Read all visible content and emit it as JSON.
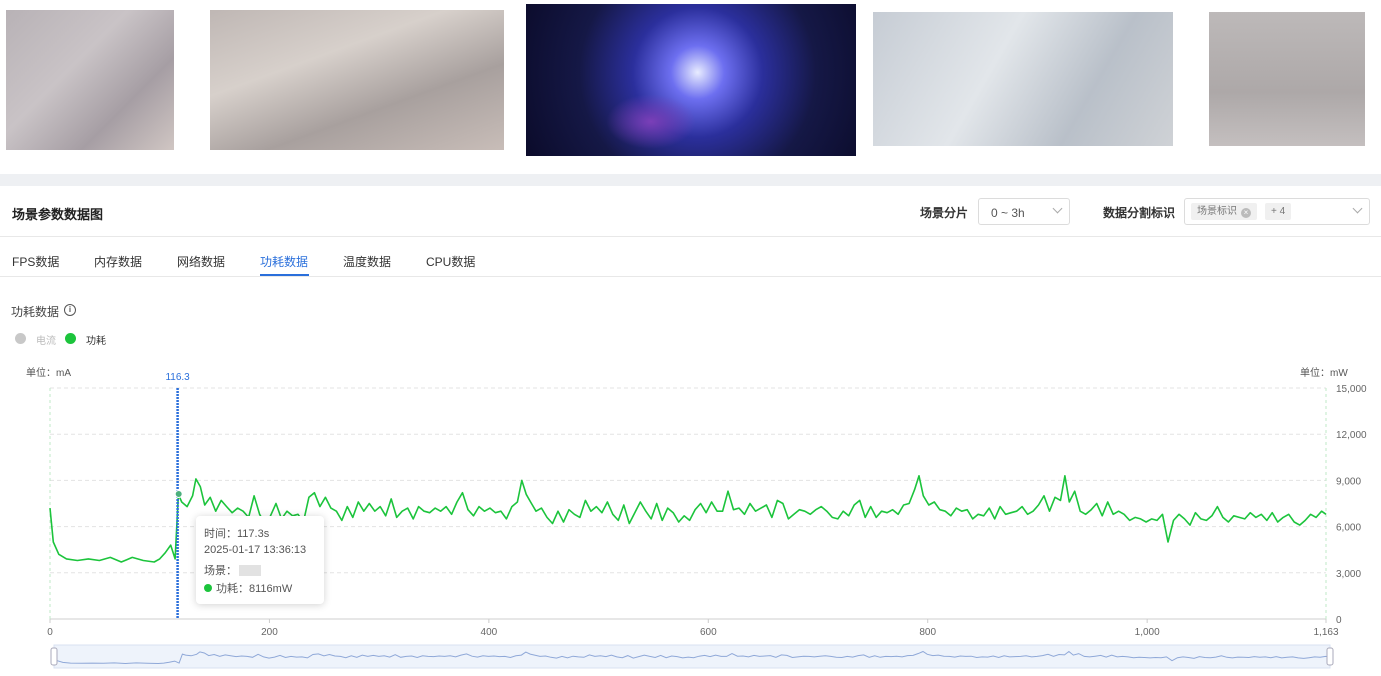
{
  "thumbnails": [
    "thumb-1",
    "thumb-2",
    "thumb-3",
    "thumb-4",
    "thumb-5"
  ],
  "header": {
    "title": "场景参数数据图",
    "slice_label": "场景分片",
    "slice_value": "0 ~ 3h",
    "split_label": "数据分割标识",
    "split_tag": "场景标识",
    "split_more": "+ 4"
  },
  "tabs": [
    {
      "label": "FPS数据",
      "active": false
    },
    {
      "label": "内存数据",
      "active": false
    },
    {
      "label": "网络数据",
      "active": false
    },
    {
      "label": "功耗数据",
      "active": true
    },
    {
      "label": "温度数据",
      "active": false
    },
    {
      "label": "CPU数据",
      "active": false
    }
  ],
  "section": {
    "title": "功耗数据",
    "info_icon": "i"
  },
  "legend": {
    "current": {
      "label": "电流",
      "color": "#c8c8c8"
    },
    "power": {
      "label": "功耗",
      "color": "#1cc43c"
    }
  },
  "units": {
    "left": "单位：mA",
    "right": "单位：mW"
  },
  "tooltip": {
    "time": "时间：117.3s",
    "datetime": "2025-01-17 13:36:13",
    "scene": "场景：",
    "power": "功耗：8116mW"
  },
  "cursor_label": "116.3",
  "colors": {
    "accent": "#2a6fdb",
    "series": "#1cc43c",
    "grid": "#e3e3e3"
  },
  "chart_data": {
    "type": "line",
    "title": "",
    "xlabel": "",
    "ylabel_right": "单位：mW",
    "ylabel_left": "单位：mA",
    "xlim": [
      0,
      1163
    ],
    "ylim": [
      0,
      15000
    ],
    "x_ticks": [
      0,
      200,
      400,
      600,
      800,
      1000,
      1163
    ],
    "x_tick_labels": [
      "0",
      "200",
      "400",
      "600",
      "800",
      "1,000",
      "1,163"
    ],
    "y_ticks": [
      0,
      3000,
      6000,
      9000,
      12000,
      15000
    ],
    "y_tick_labels": [
      "0",
      "3,000",
      "6,000",
      "9,000",
      "12,000",
      "15,000"
    ],
    "grid": true,
    "cursor_x": 116.3,
    "series": [
      {
        "name": "功耗",
        "points": [
          [
            0,
            7200
          ],
          [
            3,
            5000
          ],
          [
            8,
            4200
          ],
          [
            15,
            3900
          ],
          [
            25,
            3800
          ],
          [
            35,
            3900
          ],
          [
            45,
            3800
          ],
          [
            55,
            4000
          ],
          [
            65,
            3700
          ],
          [
            75,
            4000
          ],
          [
            85,
            3800
          ],
          [
            95,
            3700
          ],
          [
            100,
            3900
          ],
          [
            105,
            4300
          ],
          [
            110,
            4800
          ],
          [
            114,
            3900
          ],
          [
            117,
            8100
          ],
          [
            120,
            7600
          ],
          [
            125,
            7300
          ],
          [
            130,
            8000
          ],
          [
            133,
            9100
          ],
          [
            137,
            8600
          ],
          [
            141,
            7400
          ],
          [
            146,
            7900
          ],
          [
            151,
            7000
          ],
          [
            156,
            7700
          ],
          [
            161,
            7300
          ],
          [
            166,
            6900
          ],
          [
            171,
            7200
          ],
          [
            176,
            7000
          ],
          [
            181,
            6600
          ],
          [
            186,
            8000
          ],
          [
            191,
            6800
          ],
          [
            196,
            6200
          ],
          [
            201,
            6700
          ],
          [
            206,
            7500
          ],
          [
            211,
            6500
          ],
          [
            216,
            7000
          ],
          [
            221,
            6700
          ],
          [
            226,
            6800
          ],
          [
            231,
            6300
          ],
          [
            236,
            7900
          ],
          [
            241,
            8200
          ],
          [
            246,
            7300
          ],
          [
            251,
            7900
          ],
          [
            256,
            7200
          ],
          [
            261,
            7000
          ],
          [
            266,
            6400
          ],
          [
            271,
            7300
          ],
          [
            276,
            6600
          ],
          [
            281,
            7600
          ],
          [
            286,
            7000
          ],
          [
            291,
            7500
          ],
          [
            296,
            7000
          ],
          [
            301,
            7300
          ],
          [
            306,
            6700
          ],
          [
            311,
            7800
          ],
          [
            316,
            6600
          ],
          [
            321,
            7000
          ],
          [
            326,
            7200
          ],
          [
            331,
            6500
          ],
          [
            336,
            7300
          ],
          [
            341,
            7000
          ],
          [
            346,
            6900
          ],
          [
            351,
            7200
          ],
          [
            356,
            7000
          ],
          [
            361,
            7300
          ],
          [
            366,
            6800
          ],
          [
            371,
            7600
          ],
          [
            376,
            8200
          ],
          [
            381,
            7100
          ],
          [
            386,
            6700
          ],
          [
            391,
            7300
          ],
          [
            396,
            7000
          ],
          [
            401,
            7200
          ],
          [
            406,
            6900
          ],
          [
            411,
            7000
          ],
          [
            416,
            6500
          ],
          [
            421,
            7300
          ],
          [
            426,
            7600
          ],
          [
            430,
            9000
          ],
          [
            434,
            8100
          ],
          [
            438,
            7600
          ],
          [
            443,
            7000
          ],
          [
            448,
            7200
          ],
          [
            453,
            6600
          ],
          [
            458,
            6200
          ],
          [
            463,
            7000
          ],
          [
            468,
            6300
          ],
          [
            473,
            7100
          ],
          [
            478,
            6800
          ],
          [
            483,
            6600
          ],
          [
            488,
            7700
          ],
          [
            493,
            7000
          ],
          [
            498,
            7300
          ],
          [
            503,
            6900
          ],
          [
            508,
            7600
          ],
          [
            513,
            6800
          ],
          [
            518,
            6400
          ],
          [
            523,
            7400
          ],
          [
            528,
            6200
          ],
          [
            533,
            6900
          ],
          [
            538,
            7600
          ],
          [
            543,
            7000
          ],
          [
            548,
            6500
          ],
          [
            553,
            7500
          ],
          [
            558,
            6400
          ],
          [
            563,
            7200
          ],
          [
            568,
            6900
          ],
          [
            573,
            6300
          ],
          [
            578,
            6700
          ],
          [
            583,
            6400
          ],
          [
            588,
            7100
          ],
          [
            593,
            7500
          ],
          [
            598,
            6900
          ],
          [
            603,
            7600
          ],
          [
            608,
            7000
          ],
          [
            613,
            7000
          ],
          [
            618,
            8300
          ],
          [
            623,
            7100
          ],
          [
            628,
            7200
          ],
          [
            633,
            6800
          ],
          [
            638,
            7500
          ],
          [
            643,
            7000
          ],
          [
            648,
            7200
          ],
          [
            653,
            7400
          ],
          [
            658,
            6600
          ],
          [
            663,
            7700
          ],
          [
            668,
            7500
          ],
          [
            673,
            6500
          ],
          [
            678,
            6800
          ],
          [
            683,
            7100
          ],
          [
            688,
            7000
          ],
          [
            693,
            6800
          ],
          [
            698,
            7100
          ],
          [
            703,
            7300
          ],
          [
            708,
            7000
          ],
          [
            713,
            6600
          ],
          [
            718,
            6500
          ],
          [
            723,
            7000
          ],
          [
            728,
            6700
          ],
          [
            733,
            7400
          ],
          [
            738,
            7700
          ],
          [
            743,
            6600
          ],
          [
            748,
            7300
          ],
          [
            753,
            6600
          ],
          [
            758,
            7000
          ],
          [
            763,
            6900
          ],
          [
            768,
            7100
          ],
          [
            773,
            6800
          ],
          [
            778,
            7400
          ],
          [
            783,
            7500
          ],
          [
            788,
            8400
          ],
          [
            792,
            9300
          ],
          [
            796,
            8000
          ],
          [
            801,
            7400
          ],
          [
            806,
            7600
          ],
          [
            811,
            7100
          ],
          [
            816,
            7000
          ],
          [
            821,
            6700
          ],
          [
            826,
            7200
          ],
          [
            831,
            7000
          ],
          [
            836,
            7100
          ],
          [
            841,
            6500
          ],
          [
            846,
            6800
          ],
          [
            851,
            6700
          ],
          [
            856,
            7200
          ],
          [
            861,
            6500
          ],
          [
            866,
            7300
          ],
          [
            871,
            6800
          ],
          [
            876,
            6900
          ],
          [
            881,
            7000
          ],
          [
            886,
            7300
          ],
          [
            891,
            6800
          ],
          [
            896,
            7000
          ],
          [
            901,
            7400
          ],
          [
            906,
            8000
          ],
          [
            911,
            7000
          ],
          [
            916,
            7900
          ],
          [
            921,
            7700
          ],
          [
            925,
            9300
          ],
          [
            929,
            7600
          ],
          [
            934,
            8300
          ],
          [
            939,
            7000
          ],
          [
            944,
            6800
          ],
          [
            949,
            7100
          ],
          [
            954,
            7500
          ],
          [
            959,
            6700
          ],
          [
            964,
            7600
          ],
          [
            969,
            6800
          ],
          [
            974,
            7000
          ],
          [
            979,
            6800
          ],
          [
            984,
            6400
          ],
          [
            989,
            6600
          ],
          [
            994,
            6500
          ],
          [
            999,
            6300
          ],
          [
            1004,
            6500
          ],
          [
            1009,
            6400
          ],
          [
            1014,
            6800
          ],
          [
            1019,
            5000
          ],
          [
            1024,
            6400
          ],
          [
            1029,
            6800
          ],
          [
            1034,
            6500
          ],
          [
            1039,
            6100
          ],
          [
            1044,
            6900
          ],
          [
            1049,
            6500
          ],
          [
            1054,
            6400
          ],
          [
            1059,
            6700
          ],
          [
            1064,
            7300
          ],
          [
            1069,
            6600
          ],
          [
            1074,
            6300
          ],
          [
            1079,
            6700
          ],
          [
            1084,
            6600
          ],
          [
            1089,
            6500
          ],
          [
            1094,
            6900
          ],
          [
            1099,
            6600
          ],
          [
            1104,
            6800
          ],
          [
            1109,
            6400
          ],
          [
            1114,
            6900
          ],
          [
            1119,
            6300
          ],
          [
            1124,
            6600
          ],
          [
            1129,
            6800
          ],
          [
            1134,
            6300
          ],
          [
            1139,
            6100
          ],
          [
            1144,
            6400
          ],
          [
            1149,
            6800
          ],
          [
            1154,
            6600
          ],
          [
            1159,
            7000
          ],
          [
            1163,
            6800
          ]
        ]
      }
    ]
  }
}
